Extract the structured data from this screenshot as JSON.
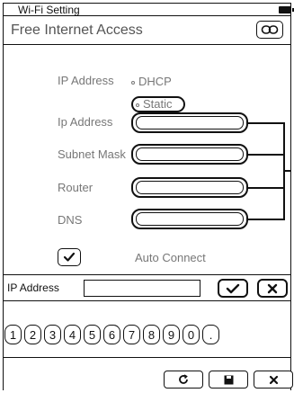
{
  "status_bar": {
    "title": "Wi-Fi Setting",
    "battery_icon": "battery-icon"
  },
  "header": {
    "title": "Free Internet Access",
    "link_icon": "link-icon"
  },
  "ip_mode": {
    "label": "IP Address",
    "options": [
      "DHCP",
      "Static"
    ],
    "selected": "Static"
  },
  "fields": [
    {
      "label": "Ip Address",
      "value": ""
    },
    {
      "label": "Subnet Mask",
      "value": ""
    },
    {
      "label": "Router",
      "value": ""
    },
    {
      "label": "DNS",
      "value": ""
    }
  ],
  "auto_connect": {
    "label": "Auto Connect",
    "checked": true
  },
  "keyboard": {
    "input_label": "IP Address",
    "input_value": "",
    "confirm_icon": "check-icon",
    "cancel_icon": "close-icon",
    "keys": [
      "1",
      "2",
      "3",
      "4",
      "5",
      "6",
      "7",
      "8",
      "9",
      "0",
      "."
    ]
  },
  "bottom_bar": {
    "buttons": [
      "refresh-icon",
      "save-icon",
      "close-icon"
    ]
  }
}
